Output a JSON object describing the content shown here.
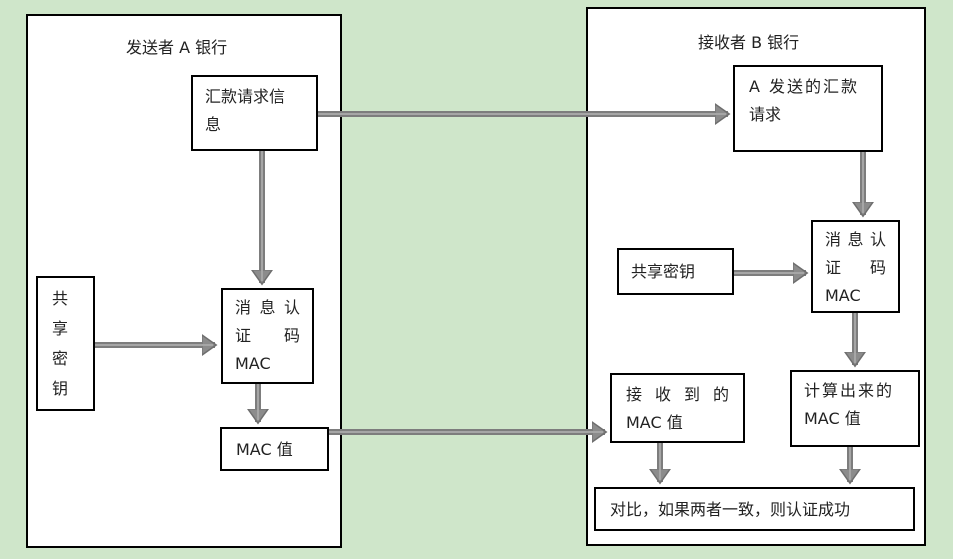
{
  "sender": {
    "title": "发送者 A 银行",
    "request_info": [
      "汇款请求信",
      "息"
    ],
    "shared_key": [
      "共",
      "享",
      "密",
      "钥"
    ],
    "mac_generator": {
      "line1": [
        "消",
        "息",
        "认"
      ],
      "line2": [
        "证",
        "码"
      ],
      "line3": "MAC"
    },
    "mac_value": "MAC 值"
  },
  "receiver": {
    "title": "接收者 B 银行",
    "received_request": [
      "A 发送的汇款",
      "请求"
    ],
    "shared_key": "共享密钥",
    "mac_generator": {
      "line1": [
        "消",
        "息",
        "认"
      ],
      "line2": [
        "证",
        "码"
      ],
      "line3": "MAC"
    },
    "received_mac": {
      "line1": [
        "接",
        "收",
        "到",
        "的"
      ],
      "line2": "MAC 值"
    },
    "computed_mac": [
      "计算出来的",
      "MAC 值"
    ],
    "compare": "对比，如果两者一致，则认证成功"
  },
  "colors": {
    "background": "#cfe6ca",
    "arrow": "#8c8c8c",
    "arrow_edge": "#6e6e6e"
  }
}
